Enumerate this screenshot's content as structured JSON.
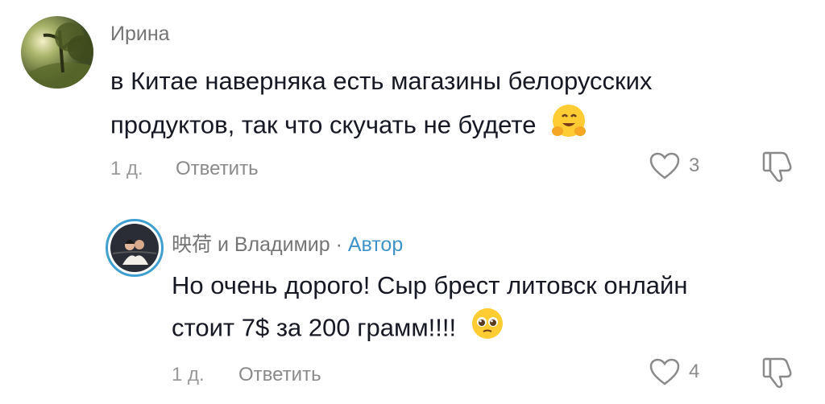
{
  "comments": [
    {
      "username": "Ирина",
      "text_line1": "в Китае наверняка есть магазины белорусских",
      "text_line2": "продуктов, так что скучать не будете",
      "emoji_icon": "hugging-face-emoji",
      "age": "1 д.",
      "reply_label": "Ответить",
      "likes": "3"
    },
    {
      "username_prefix": "映荷 и Владимир ·",
      "author_label": "Автор",
      "text_line1": "Но очень дорого! Сыр брест литовск онлайн",
      "text_line2": "стоит 7$ за 200 грамм!!!!",
      "emoji_icon": "pleading-face-emoji",
      "age": "1 д.",
      "reply_label": "Ответить",
      "likes": "4"
    }
  ],
  "colors": {
    "accent": "#3e93c8",
    "muted": "#9a9a9a",
    "text": "#161823"
  }
}
